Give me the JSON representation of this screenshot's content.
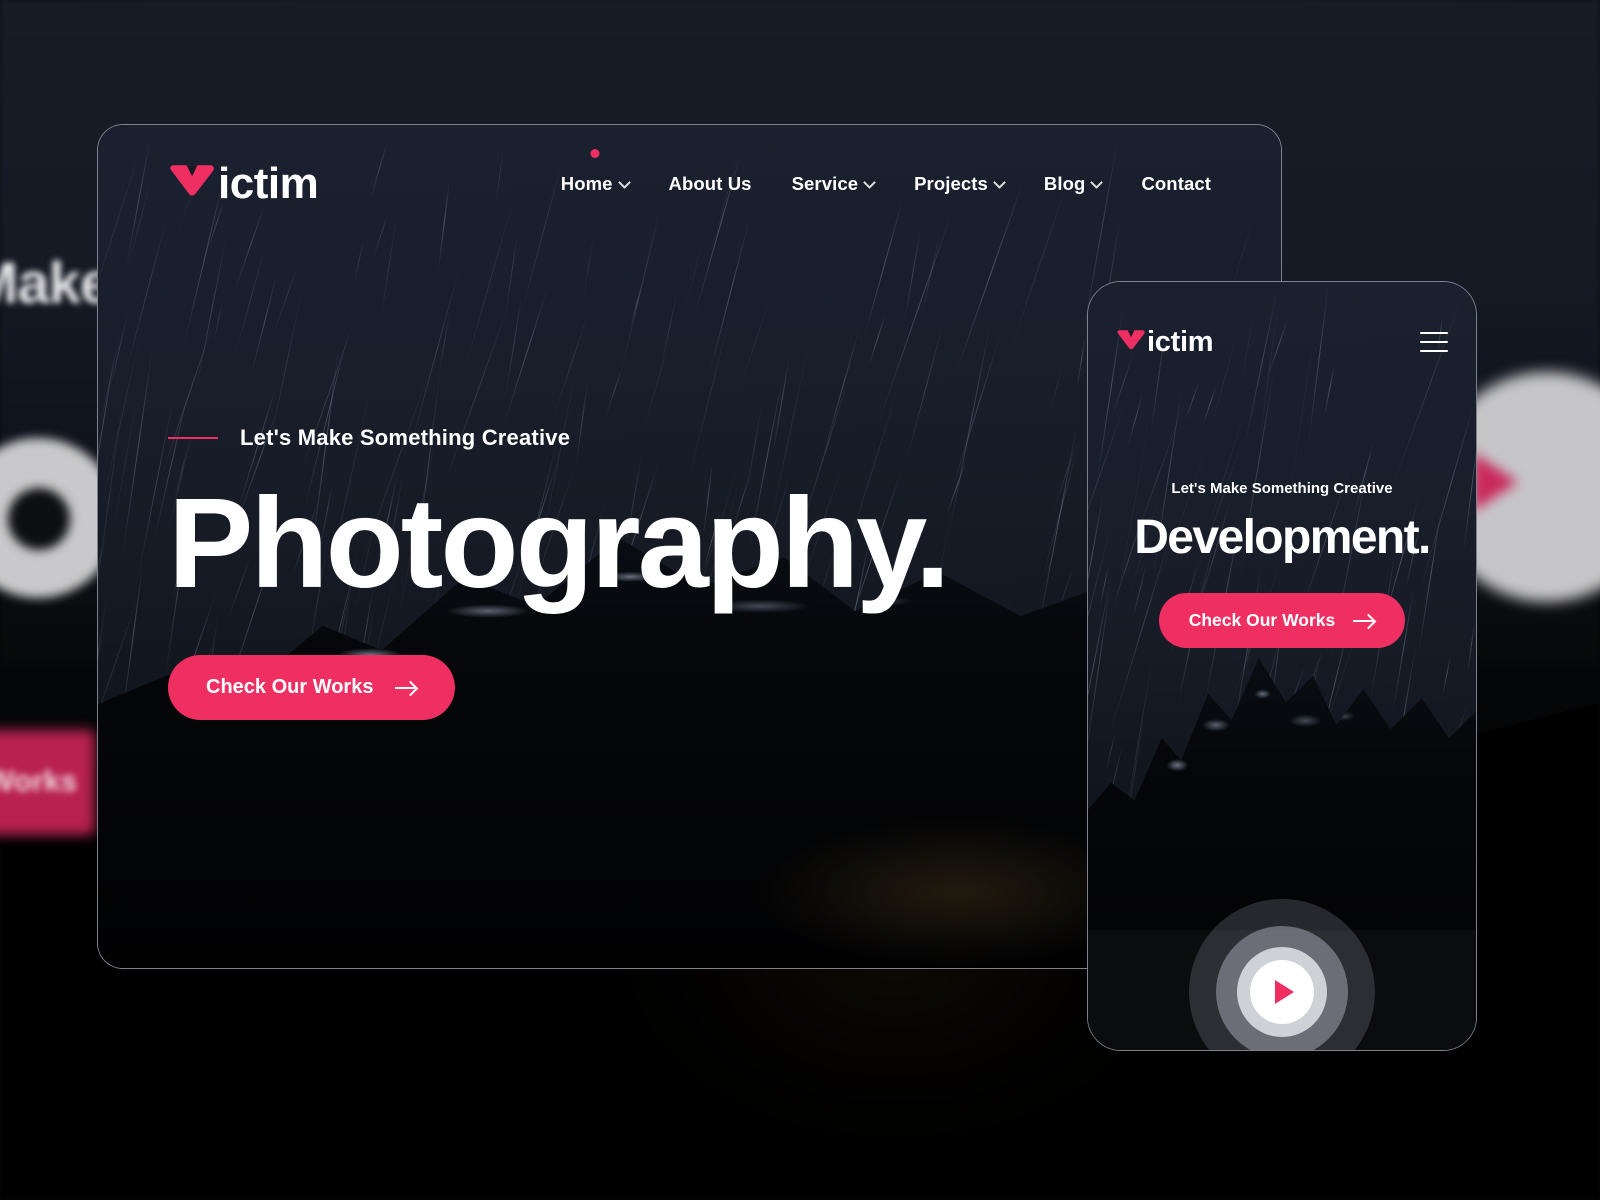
{
  "brand": {
    "name": "ictim",
    "logo_icon": "v-mark-logo-icon",
    "accent_color": "#ef2f62"
  },
  "desktop": {
    "nav": {
      "items": [
        {
          "label": "Home",
          "has_dropdown": true,
          "active": true,
          "icon": "chevron-down-icon"
        },
        {
          "label": "About Us",
          "has_dropdown": false,
          "active": false,
          "icon": ""
        },
        {
          "label": "Service",
          "has_dropdown": true,
          "active": false,
          "icon": "chevron-down-icon"
        },
        {
          "label": "Projects",
          "has_dropdown": true,
          "active": false,
          "icon": "chevron-down-icon"
        },
        {
          "label": "Blog",
          "has_dropdown": true,
          "active": false,
          "icon": "chevron-down-icon"
        },
        {
          "label": "Contact",
          "has_dropdown": false,
          "active": false,
          "icon": ""
        }
      ]
    },
    "hero": {
      "eyebrow": "Let's Make Something Creative",
      "title": "Photography.",
      "cta_label": "Check Our Works",
      "cta_icon": "arrow-right-icon"
    },
    "play_button_icon": "play-circle-icon"
  },
  "phone": {
    "menu_icon": "hamburger-menu-icon",
    "hero": {
      "eyebrow": "Let's Make Something Creative",
      "title": "Development.",
      "cta_label": "Check Our Works",
      "cta_icon": "arrow-right-icon"
    },
    "play_button_icon": "play-circle-icon"
  },
  "backdrop": {
    "ghost_heading": "Make",
    "ghost_button_label": "Works",
    "ghost_play_icon": "play-circle-icon"
  }
}
